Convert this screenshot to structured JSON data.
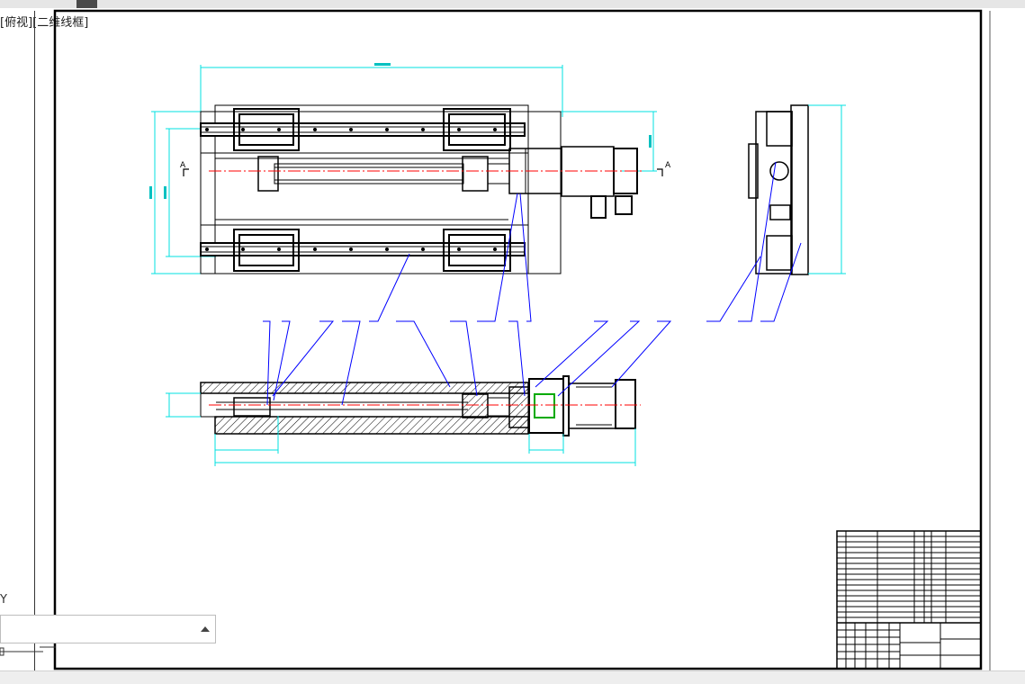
{
  "window": {
    "view_label": "[俯视][二维线框]"
  },
  "ucs": {
    "y_label": "Y"
  },
  "drawing": {
    "section_mark_left": "A",
    "section_mark_right": "A",
    "colors": {
      "outline": "#000000",
      "dimension": "#00e0e0",
      "centerline": "#ff0000",
      "leader": "#0000ff",
      "hatch": "#000000",
      "coupling": "#00aa00"
    },
    "balloon_count": 20,
    "title_block_rows": 16
  }
}
